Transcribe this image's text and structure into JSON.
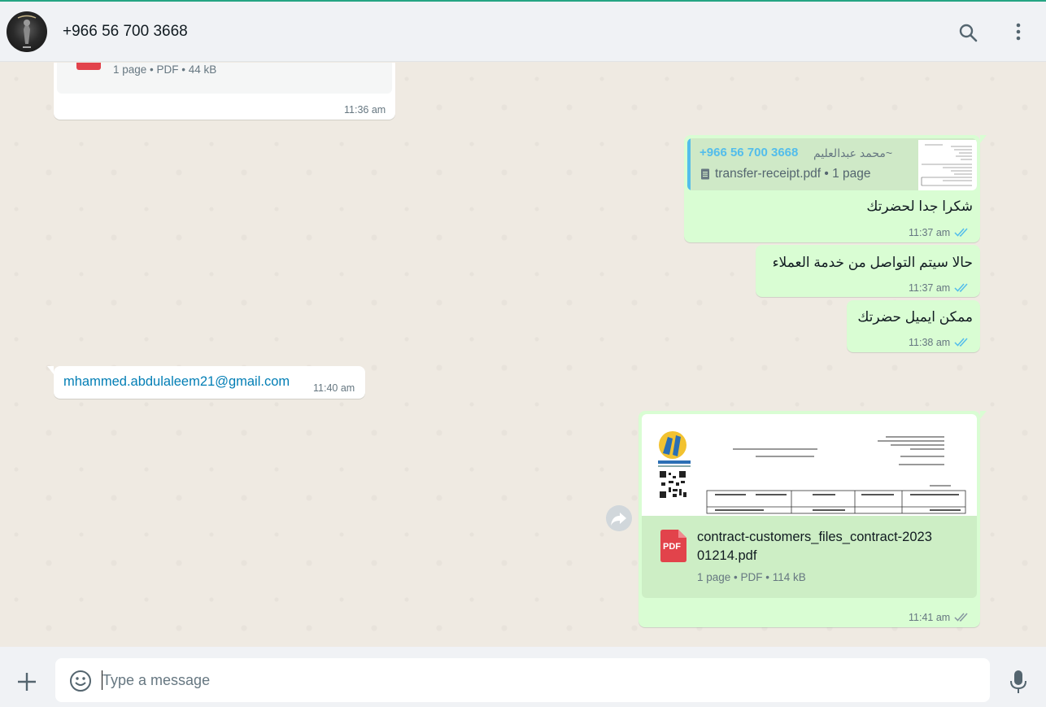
{
  "header": {
    "contact_name": "+966 56 700 3668"
  },
  "messages": {
    "doc1": {
      "meta": "1 page • PDF • 44 kB",
      "time": "11:36 am"
    },
    "reply": {
      "quoted_sender": "+966 56 700 3668",
      "quoted_name": "~محمد عبدالعليم",
      "quoted_file": "transfer-receipt.pdf • 1 page",
      "text": "شكرا جدا لحضرتك",
      "time": "11:37 am"
    },
    "msg2": {
      "text": "حالا سيتم التواصل من خدمة العملاء",
      "time": "11:37 am"
    },
    "msg3": {
      "text": "ممكن ايميل حضرتك",
      "time": "11:38 am"
    },
    "email": {
      "text": "mhammed.abdulaleem21@gmail.com",
      "time": "11:40 am"
    },
    "doc2": {
      "filename_line1": "contract-customers_files_contract-2023",
      "filename_line2": "01214.pdf",
      "meta": "1 page • PDF • 114 kB",
      "pdf_label": "PDF",
      "time": "11:41 am"
    }
  },
  "composer": {
    "placeholder": "Type a message"
  },
  "colors": {
    "outgoing_bubble": "#d9fdd3",
    "incoming_bubble": "#ffffff",
    "accent": "#25a583",
    "read_ticks": "#53bdeb",
    "link": "#027eb5",
    "pdf_red": "#e2434b"
  },
  "icons": [
    "search-icon",
    "menu-icon",
    "forward-icon",
    "pdf-icon",
    "file-icon",
    "read-receipt-icon",
    "delivered-icon",
    "plus-icon",
    "emoji-icon",
    "mic-icon"
  ]
}
